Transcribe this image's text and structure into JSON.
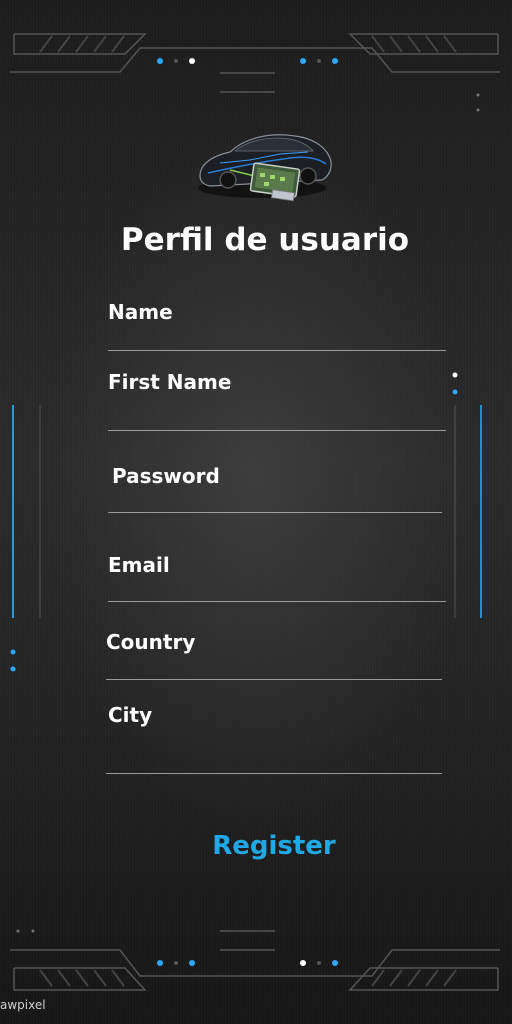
{
  "header": {
    "title": "Perfil de usuario",
    "logo_icon": "car-ecu-icon"
  },
  "form": {
    "fields": [
      {
        "label": "Name",
        "value": ""
      },
      {
        "label": "First Name",
        "value": ""
      },
      {
        "label": "Password",
        "value": ""
      },
      {
        "label": "Email",
        "value": ""
      },
      {
        "label": "Country",
        "value": ""
      },
      {
        "label": "City",
        "value": ""
      }
    ],
    "register_label": "Register"
  },
  "watermark": "awpixel",
  "colors": {
    "accent": "#1ea8e6",
    "text": "#ffffff",
    "background": "#1a1a1a"
  }
}
